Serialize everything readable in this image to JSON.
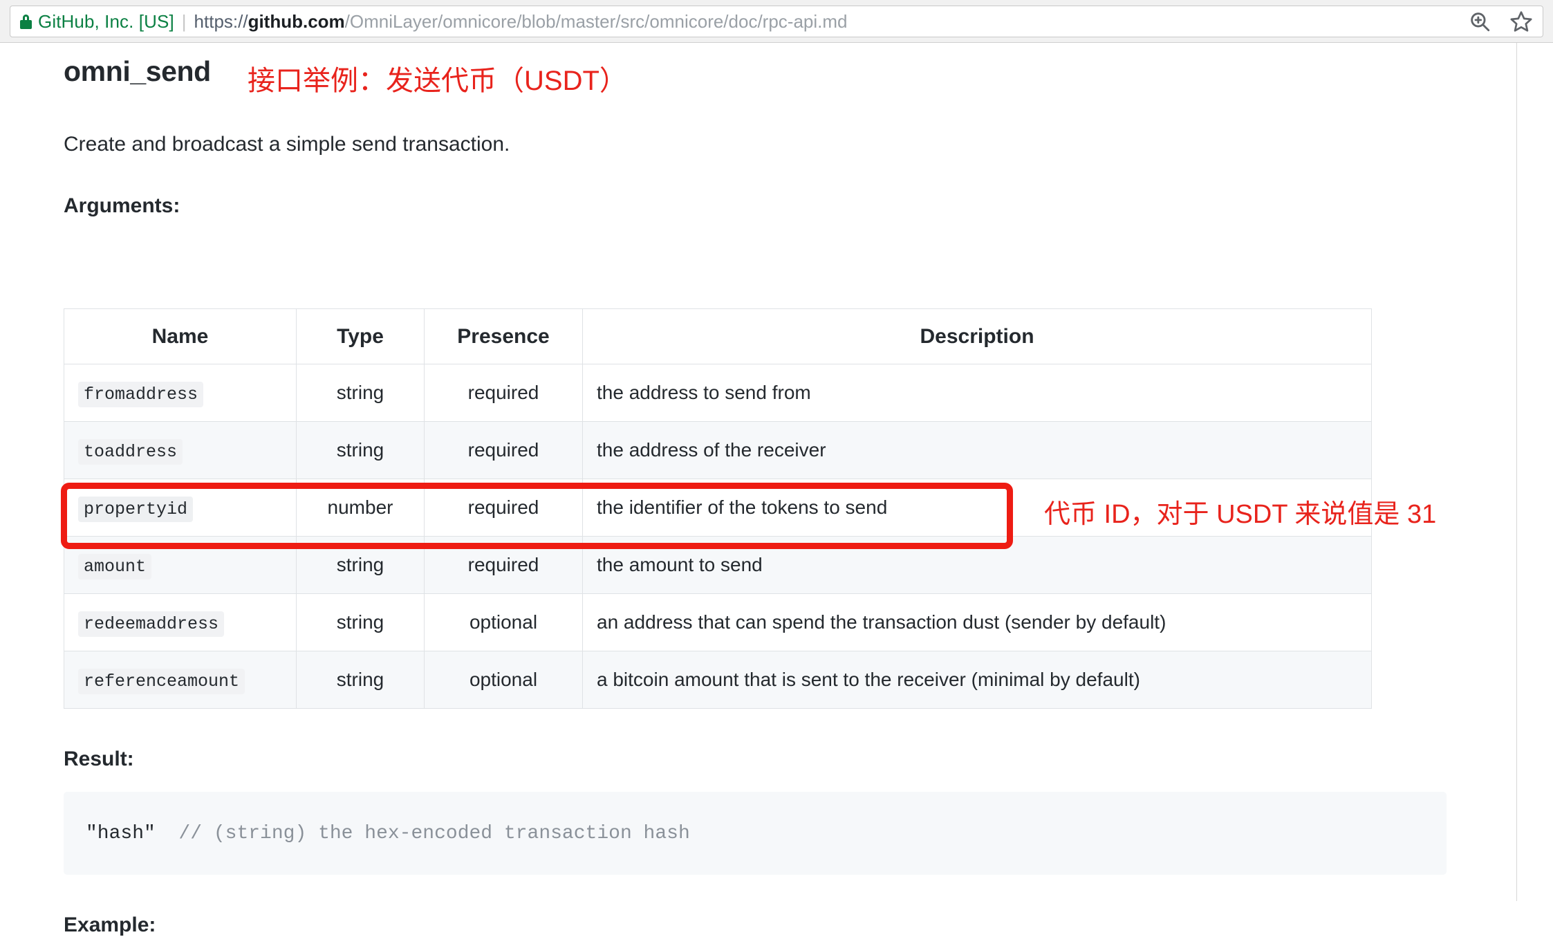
{
  "browser": {
    "security_label": "GitHub, Inc. [US]",
    "lock_icon": "lock-icon",
    "url_separator": "|",
    "url": {
      "scheme": "https://",
      "host": "github.com",
      "path": "/OmniLayer/omnicore/blob/master/src/omnicore/doc/rpc-api.md"
    },
    "actions": [
      {
        "icon": "zoom-in-icon",
        "name": "zoom-icon"
      },
      {
        "icon": "star-icon",
        "name": "bookmark-icon"
      }
    ]
  },
  "doc": {
    "title": "omni_send",
    "title_annotation": "接口举例：发送代币（USDT）",
    "intro": "Create and broadcast a simple send transaction.",
    "arguments_label": "Arguments:",
    "result_label": "Result:",
    "example_label": "Example:",
    "table": {
      "headers": [
        "Name",
        "Type",
        "Presence",
        "Description"
      ],
      "rows": [
        {
          "name": "fromaddress",
          "type": "string",
          "presence": "required",
          "description": "the address to send from"
        },
        {
          "name": "toaddress",
          "type": "string",
          "presence": "required",
          "description": "the address of the receiver"
        },
        {
          "name": "propertyid",
          "type": "number",
          "presence": "required",
          "description": "the identifier of the tokens to send",
          "highlighted": true,
          "annotation": "代币 ID，对于 USDT 来说值是 31"
        },
        {
          "name": "amount",
          "type": "string",
          "presence": "required",
          "description": "the amount to send"
        },
        {
          "name": "redeemaddress",
          "type": "string",
          "presence": "optional",
          "description": "an address that can spend the transaction dust (sender by default)"
        },
        {
          "name": "referenceamount",
          "type": "string",
          "presence": "optional",
          "description": "a bitcoin amount that is sent to the receiver (minimal by default)"
        }
      ]
    },
    "result_code": {
      "string_part": "\"hash\"",
      "comment_part": "  // (string) the hex-encoded transaction hash"
    }
  },
  "colors": {
    "annotation_red": "#e8231c",
    "highlight_box_red": "#ee1c13",
    "secure_green": "#0b8043",
    "table_border": "#dfe2e5",
    "row_stripe": "#f6f8fa",
    "code_bg": "#f6f8fa",
    "text": "#24292e"
  }
}
